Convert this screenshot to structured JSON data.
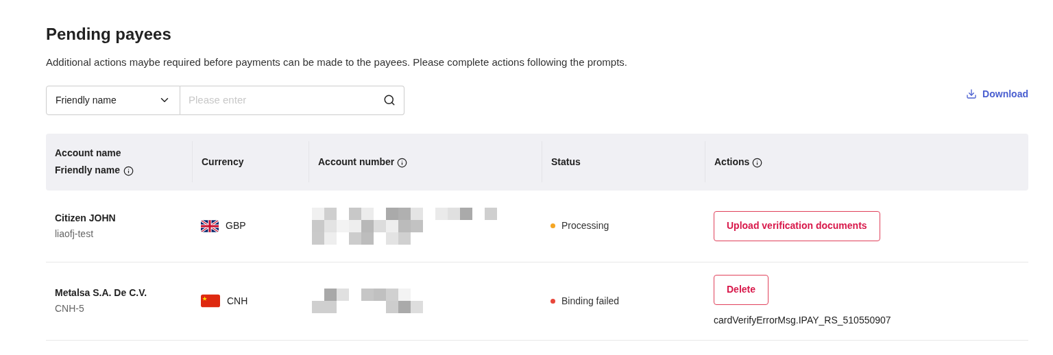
{
  "title": "Pending payees",
  "description": "Additional actions maybe required before payments can be made to the payees. Please complete actions following the prompts.",
  "filter": {
    "field": "Friendly name",
    "placeholder": "Please enter"
  },
  "download": "Download",
  "table": {
    "columns": [
      {
        "lines": [
          "Account name",
          "Friendly name"
        ],
        "info": true
      },
      {
        "lines": [
          "Currency"
        ],
        "info": false
      },
      {
        "lines": [
          "Account number"
        ],
        "info": true
      },
      {
        "lines": [
          "Status"
        ],
        "info": false
      },
      {
        "lines": [
          "Actions"
        ],
        "info": true
      }
    ],
    "rows": [
      {
        "account_name": "Citizen JOHN",
        "friendly_name": "liaofj-test",
        "kind": "uk",
        "currency": "GBP",
        "status": "Processing",
        "color": "#f5a623",
        "action": "Upload verification documents"
      },
      {
        "account_name": "Metalsa S.A. De C.V.",
        "friendly_name": "CNH-5",
        "kind": "china",
        "currency": "CNH",
        "status": "Binding failed",
        "color": "#e8463a",
        "action": "Delete",
        "message": "cardVerifyErrorMsg.IPAY_RS_510550907"
      }
    ]
  }
}
